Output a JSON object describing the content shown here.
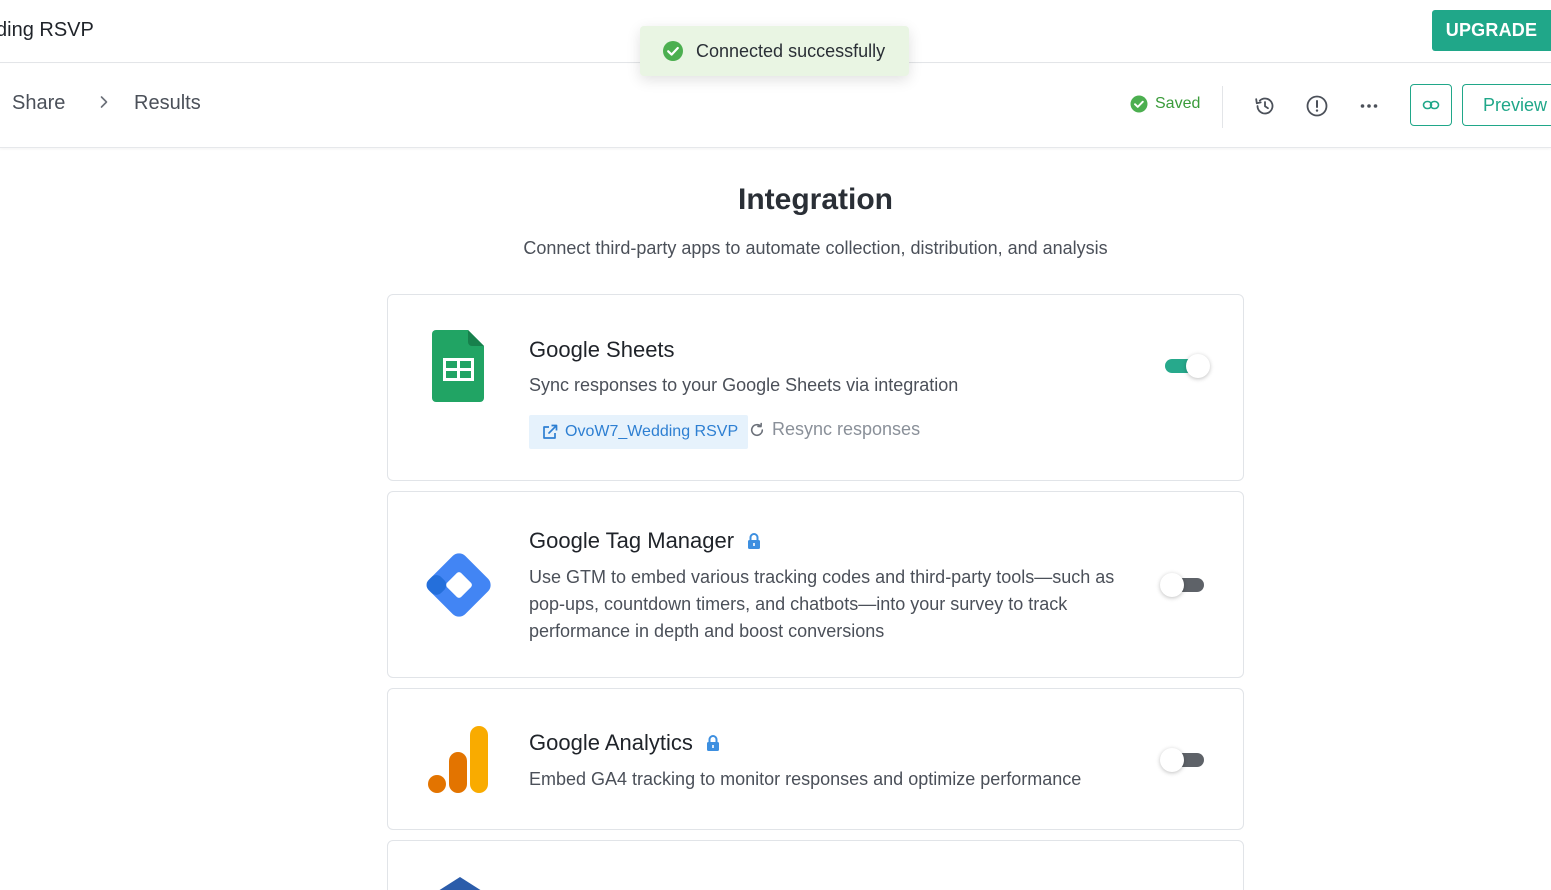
{
  "header": {
    "doc_title": "ding RSVP",
    "upgrade_label": "UPGRADE"
  },
  "toast": {
    "message": "Connected successfully"
  },
  "nav": {
    "breadcrumb": [
      "Share",
      "Results"
    ],
    "saved_label": "Saved",
    "preview_label": "Preview",
    "icons": [
      "history-icon",
      "info-icon",
      "more-icon",
      "link-icon"
    ]
  },
  "main": {
    "title": "Integration",
    "subtitle": "Connect third-party apps to automate collection, distribution, and analysis",
    "integrations": [
      {
        "name": "Google Sheets",
        "description": "Sync responses to your Google Sheets via integration",
        "locked": false,
        "enabled": true,
        "sheet_link": "OvoW7_Wedding RSVP",
        "resync_label": "Resync responses"
      },
      {
        "name": "Google Tag Manager",
        "description_lines": [
          "Use GTM to embed various tracking codes and third-party tools—such as",
          "pop-ups, countdown timers, and chatbots—into your survey to track",
          "performance in depth and boost conversions"
        ],
        "locked": true,
        "enabled": false
      },
      {
        "name": "Google Analytics",
        "description": "Embed GA4 tracking to monitor responses and optimize performance",
        "locked": true,
        "enabled": false
      }
    ]
  },
  "colors": {
    "brand": "#20a789",
    "toggle_on": "#27a98c",
    "toggle_off": "#5e6268",
    "toast_bg": "#e9f5e3",
    "link_blue": "#2d7fd2",
    "lock_blue": "#3d8fe0"
  }
}
